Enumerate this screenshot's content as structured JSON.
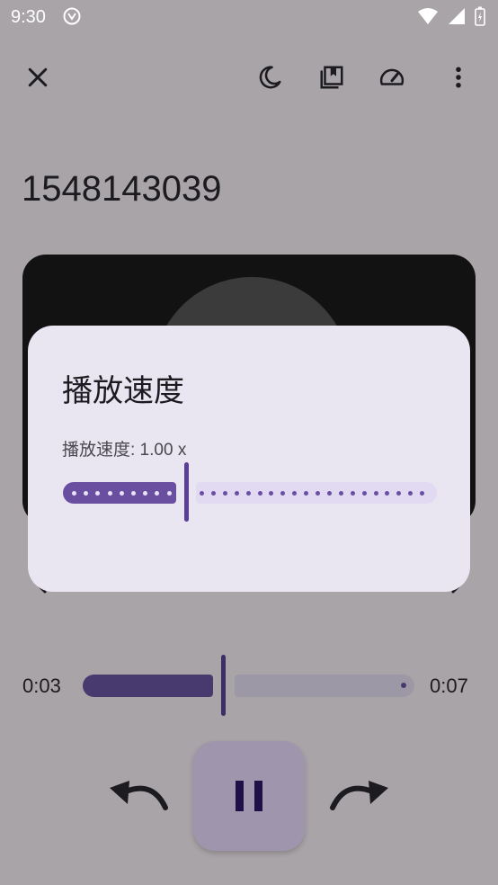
{
  "status_bar": {
    "time": "9:30"
  },
  "toolbar": {
    "close_icon": "close-icon",
    "sleep_icon": "moon-icon",
    "bookmark_icon": "bookmark-icon",
    "speed_icon": "speedometer-icon",
    "more_icon": "more-vert-icon"
  },
  "title": "1548143039",
  "dialog": {
    "title": "播放速度",
    "label": "播放速度: 1.00 x",
    "speed_value": 1.0
  },
  "player": {
    "current_time": "0:03",
    "total_time": "0:07",
    "progress_fraction": 0.43
  },
  "controls": {
    "rewind_icon": "rewind-icon",
    "pause_icon": "pause-icon",
    "forward_icon": "forward-icon"
  },
  "colors": {
    "background": "#a8a4a8",
    "dialog_bg": "#e9e5f1",
    "accent": "#6a4fa1",
    "play_button": "#9f96ae"
  }
}
